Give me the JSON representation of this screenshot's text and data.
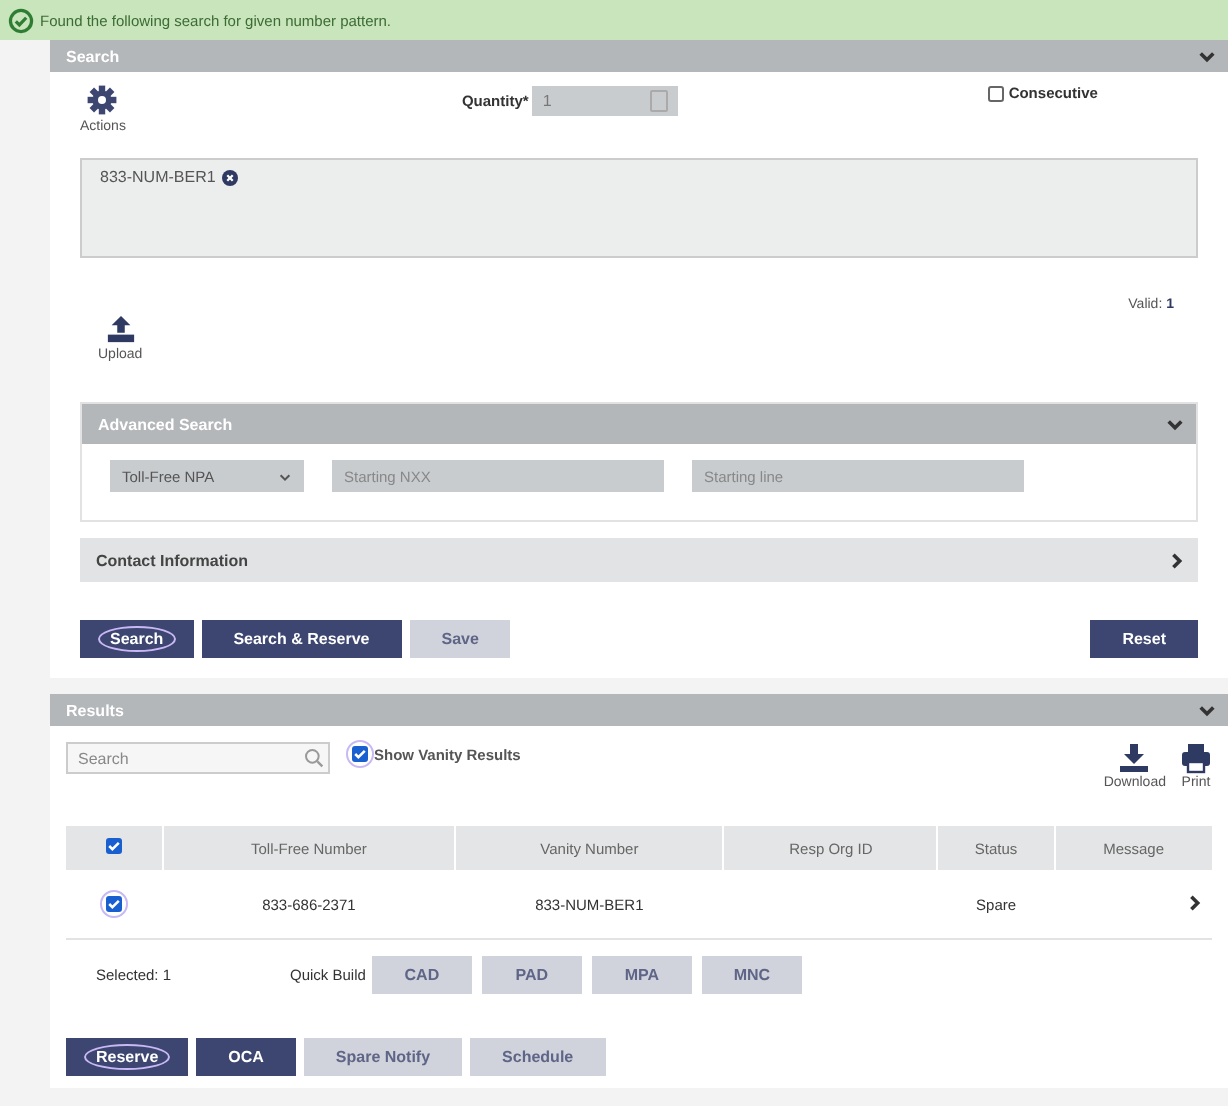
{
  "banner": {
    "message": "Found the following search for given number pattern."
  },
  "search_panel": {
    "title": "Search",
    "expanded": true,
    "actions_label": "Actions",
    "quantity_label": "Quantity*",
    "quantity_value": "1",
    "consecutive": {
      "label": "Consecutive",
      "checked": false
    },
    "numbers": [
      "833-NUM-BER1"
    ],
    "valid_label": "Valid:",
    "valid_count": "1",
    "upload_label": "Upload",
    "advanced": {
      "title": "Advanced Search",
      "expanded": true,
      "npa_value": "Toll-Free NPA",
      "nxx_placeholder": "Starting NXX",
      "line_placeholder": "Starting line"
    },
    "contact": {
      "title": "Contact Information",
      "expanded": false
    },
    "buttons": [
      {
        "label": "Search",
        "disabled": false,
        "focused": true
      },
      {
        "label": "Search & Reserve",
        "disabled": false,
        "focused": false
      },
      {
        "label": "Save",
        "disabled": true,
        "focused": false
      }
    ],
    "reset_button": {
      "label": "Reset",
      "disabled": false,
      "focused": false
    }
  },
  "results": {
    "title": "Results",
    "expanded": true,
    "search_placeholder": "Search",
    "show_vanity": {
      "label": "Show Vanity Results",
      "checked": true
    },
    "download_label": "Download",
    "print_label": "Print",
    "select_all": {
      "checked": true
    },
    "columns": [
      "Toll-Free Number",
      "Vanity Number",
      "Resp Org ID",
      "Status",
      "Message"
    ],
    "rows": [
      {
        "checked": true,
        "cells": [
          "833-686-2371",
          "833-NUM-BER1",
          "",
          "Spare",
          ""
        ]
      }
    ],
    "selected_label": "Selected: 1",
    "quick_build_label": "Quick Build",
    "quick_build": [
      {
        "label": "CAD",
        "disabled": true
      },
      {
        "label": "PAD",
        "disabled": true
      },
      {
        "label": "MPA",
        "disabled": true
      },
      {
        "label": "MNC",
        "disabled": true
      }
    ],
    "buttons": [
      {
        "label": "Reserve",
        "disabled": false,
        "focused": true
      },
      {
        "label": "OCA",
        "disabled": false,
        "focused": false
      },
      {
        "label": "Spare Notify",
        "disabled": true,
        "focused": false
      },
      {
        "label": "Schedule",
        "disabled": true,
        "focused": false
      }
    ]
  }
}
